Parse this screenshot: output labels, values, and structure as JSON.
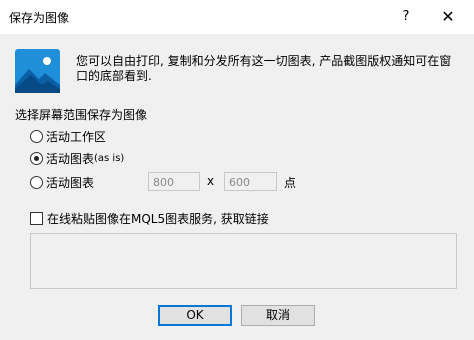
{
  "window": {
    "title": "保存为图像",
    "help": "?",
    "close": "✕"
  },
  "info_text": "您可以自由打印, 复制和分发所有这一切图表, 产品截图版权通知可在窗口的底部看到.",
  "section_label": "选择屏幕范围保存为图像",
  "options": [
    {
      "label": "活动工作区",
      "suffix": "",
      "checked": false
    },
    {
      "label": "活动图表",
      "suffix": "(as is)",
      "checked": true
    },
    {
      "label": "活动图表",
      "suffix": "",
      "checked": false
    }
  ],
  "size": {
    "width": "800",
    "height": "600",
    "separator": "x",
    "unit": "点"
  },
  "mql5": {
    "label": "在线粘贴图像在MQL5图表服务, 获取链接",
    "checked": false
  },
  "buttons": {
    "ok": "OK",
    "cancel": "取消"
  },
  "colors": {
    "icon_bg": "#1e8fd8",
    "default_button_border": "#0078d7"
  }
}
